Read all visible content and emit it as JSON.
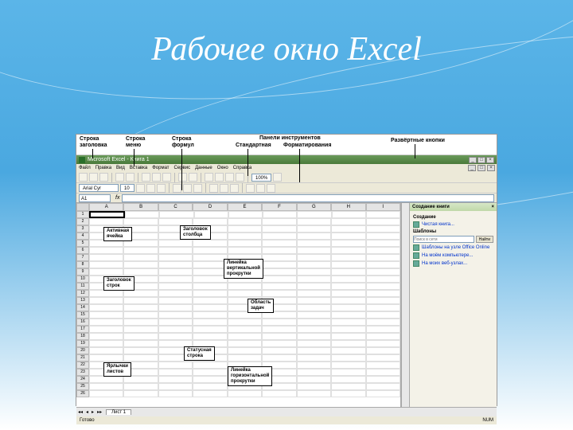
{
  "slide_title": "Рабочее окно Excel",
  "top_annotations": {
    "title_bar": "Строка\nзаголовка",
    "menu_bar": "Строка\nменю",
    "formula_bar": "Строка\nформул",
    "toolbars_label": "Панели инструментов",
    "standard": "Стандартная",
    "formatting": "Форматирования",
    "expand_buttons": "Развёртные кнопки"
  },
  "excel": {
    "app_title": "Microsoft Excel - Книга 1",
    "window_buttons": [
      "_",
      "□",
      "×"
    ],
    "menus": [
      "Файл",
      "Правка",
      "Вид",
      "Вставка",
      "Формат",
      "Сервис",
      "Данные",
      "Окно",
      "Справка"
    ],
    "font_name": "Arial Cyr",
    "font_size": "10",
    "name_box": "A1",
    "columns": [
      "A",
      "B",
      "C",
      "D",
      "E",
      "F",
      "G",
      "H",
      "I"
    ],
    "row_count": 26,
    "sheet_tab": "Лист 1",
    "status": "Готово",
    "caps": "NUM"
  },
  "callouts": {
    "active_cell": "Активная\nячейка",
    "col_header": "Заголовок\nстолбца",
    "row_header": "Заголовок\nстрок",
    "vscroll": "Линейка\nвертикальной\nпрокрутки",
    "task_area": "Область\nзадач",
    "status_bar": "Статусная\nстрока",
    "sheet_tabs": "Ярлычки\nлистов",
    "hscroll": "Линейка\nгоризонтальной\nпрокрутки"
  },
  "taskpane": {
    "title": "Создание книги",
    "create": "Создание",
    "templates": "Шаблоны",
    "search_placeholder": "Поиск в сети",
    "search_btn": "Найти",
    "links": [
      "Шаблоны на узле Office Online",
      "На моём компьютере...",
      "На моих веб-узлах..."
    ]
  }
}
